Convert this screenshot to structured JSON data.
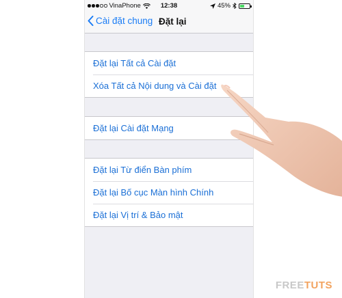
{
  "status_bar": {
    "carrier": "VinaPhone",
    "time": "12:38",
    "battery": "45%",
    "battery_level": 0.45
  },
  "nav": {
    "back_label": "Cài đặt chung",
    "title": "Đặt lại"
  },
  "groups": [
    [
      "Đặt lại Tất cả Cài đặt",
      "Xóa Tất cả Nội dung và Cài đặt"
    ],
    [
      "Đặt lại Cài đặt Mạng"
    ],
    [
      "Đặt lại Từ điển Bàn phím",
      "Đặt lại Bố cục Màn hình Chính",
      "Đặt lại Vị trí & Bảo mật"
    ]
  ],
  "watermark": {
    "part1": "FREE",
    "part2": "TUTS"
  },
  "colors": {
    "accent": "#1a7cf5",
    "row_text": "#1a6fd6",
    "background": "#efeff4"
  },
  "icons": [
    "signal-icon",
    "wifi-icon",
    "location-icon",
    "bluetooth-icon",
    "battery-icon",
    "chevron-left-icon"
  ]
}
